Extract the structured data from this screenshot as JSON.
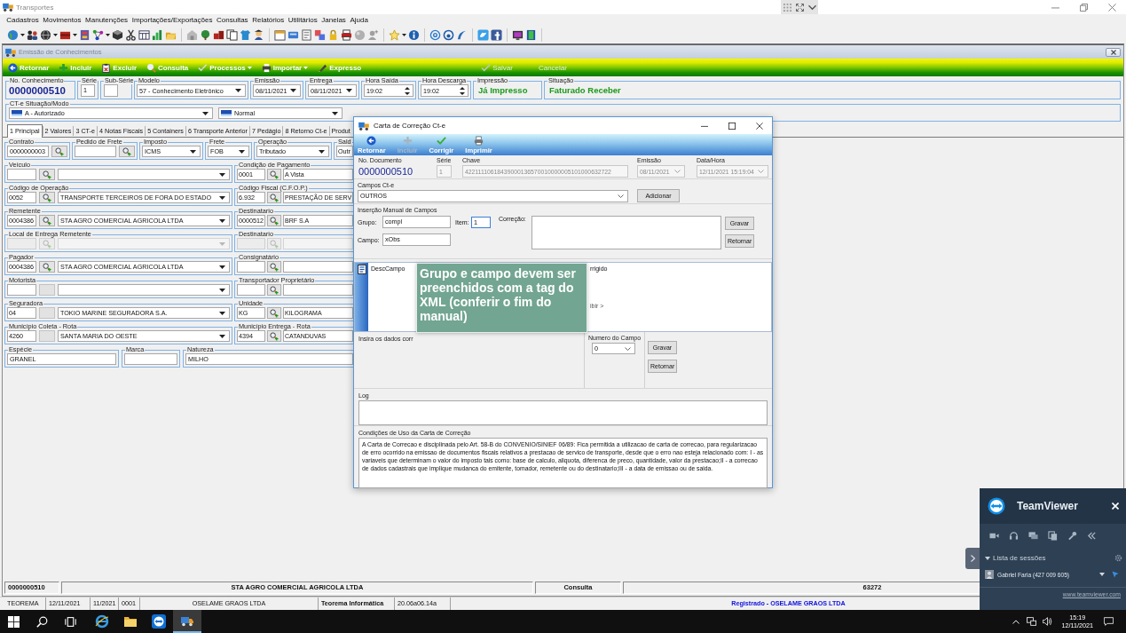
{
  "app_window": {
    "title": "Transportes"
  },
  "menu": [
    "Cadastros",
    "Movimentos",
    "Manutenções",
    "Importações/Exportações",
    "Consultas",
    "Relatórios",
    "Utilitários",
    "Janelas",
    "Ajuda"
  ],
  "child_window": {
    "title": "Emissão de Conhecimentos",
    "toolbar": [
      {
        "label": "Retornar",
        "kind": "back",
        "dropdown": false,
        "disabled": false
      },
      {
        "label": "Incluir",
        "kind": "add",
        "dropdown": false,
        "disabled": false
      },
      {
        "label": "Excluir",
        "kind": "delete",
        "dropdown": false,
        "disabled": false
      },
      {
        "label": "Consulta",
        "kind": "search",
        "dropdown": false,
        "disabled": false
      },
      {
        "label": "Processos",
        "kind": "process",
        "dropdown": true,
        "disabled": false
      },
      {
        "label": "Importar",
        "kind": "import",
        "dropdown": true,
        "disabled": false
      },
      {
        "label": "Expresso",
        "kind": "express",
        "dropdown": false,
        "disabled": false
      }
    ],
    "edit_toolbar": [
      {
        "label": "Salvar",
        "kind": "save",
        "disabled": true
      },
      {
        "label": "Cancelar",
        "kind": "cancel",
        "disabled": true
      }
    ],
    "header": [
      {
        "label": "No. Conhecimento",
        "kind": "number",
        "value": "0000000510"
      },
      {
        "label": "Série",
        "kind": "input",
        "value": "1"
      },
      {
        "label": "Sub-Série",
        "kind": "input"
      },
      {
        "label": "Modelo",
        "kind": "combo",
        "value": "57 - Conhecimento Eletrônico"
      },
      {
        "label": "Emissão",
        "kind": "combo",
        "value": "08/11/2021"
      },
      {
        "label": "Entrega",
        "kind": "combo",
        "value": "08/11/2021"
      },
      {
        "label": "Hora Saída",
        "kind": "spin",
        "value": "19:02"
      },
      {
        "label": "Hora Descarga",
        "kind": "spin",
        "value": "19:02"
      },
      {
        "label": "Impressão",
        "kind": "status",
        "value": "Já Impresso"
      },
      {
        "label": "Situação",
        "kind": "status",
        "value": "Faturado Receber"
      }
    ],
    "situation_mode": {
      "label": "CT-e Situação/Modo",
      "selects": [
        {
          "value": "A - Autorizado"
        },
        {
          "value": "Normal"
        }
      ]
    },
    "tabs": [
      {
        "label": "1 Principal",
        "selected": true
      },
      {
        "label": "2 Valores",
        "selected": false
      },
      {
        "label": "3 CT-e",
        "selected": false
      },
      {
        "label": "4 Notas Fiscais",
        "selected": false
      },
      {
        "label": "5 Containers",
        "selected": false
      },
      {
        "label": "6 Transporte Anterior",
        "selected": false
      },
      {
        "label": "7 Pedágio",
        "selected": false
      },
      {
        "label": "8 Retorno Ct-e",
        "selected": false
      },
      {
        "label": "Produt",
        "selected": false
      }
    ],
    "form": {
      "top": [
        {
          "label": "Contrato",
          "kind": "lookup",
          "value": "0000000003"
        },
        {
          "label": "Pedido de Frete",
          "kind": "lookup"
        },
        {
          "label": "Imposto",
          "kind": "combo",
          "value": "ICMS"
        },
        {
          "label": "Frete",
          "kind": "combo",
          "value": "FOB"
        },
        {
          "label": "Operação",
          "kind": "combo",
          "value": "Tributado"
        },
        {
          "label": "Sald",
          "kind": "text",
          "value": "Outr"
        }
      ],
      "rows": [
        {
          "left": {
            "label": "Veículo",
            "kind": "lookup",
            "dropdown": true,
            "disabled": false
          },
          "right": {
            "label": "Condição de Pagamento",
            "code": "0001",
            "kind": "lookup",
            "name": "A Vista",
            "dropdown": false,
            "disabled": false
          }
        },
        {
          "left": {
            "label": "Código de Operação",
            "code": "0052",
            "kind": "lookup",
            "name": "TRANSPORTE TERCEIROS DE FORA DO ESTADO",
            "dropdown": true,
            "disabled": false
          },
          "right": {
            "label": "Código Fiscal (C.F.O.P.)",
            "code": "6.932",
            "kind": "lookup",
            "name": "PRESTAÇÃO DE SERV",
            "dropdown": false,
            "disabled": false
          }
        },
        {
          "left": {
            "label": "Remetente",
            "code": "0004386",
            "kind": "lookup",
            "name": "STA AGRO COMERCIAL AGRICOLA LTDA",
            "dropdown": true,
            "disabled": false
          },
          "right": {
            "label": "Destinatario",
            "code": "0000512",
            "kind": "lookup",
            "name": "BRF S.A",
            "dropdown": false,
            "disabled": false
          }
        },
        {
          "left": {
            "label": "Local de Entrega Remetente",
            "kind": "lookup",
            "dropdown": true,
            "disabled": true
          },
          "right": {
            "label": "Destinatario",
            "kind": "lookup",
            "dropdown": false,
            "disabled": true
          }
        },
        {
          "left": {
            "label": "Pagador",
            "code": "0004386",
            "kind": "lookup",
            "name": "STA AGRO COMERCIAL AGRICOLA LTDA",
            "dropdown": true,
            "disabled": false
          },
          "right": {
            "label": "Consignatário",
            "kind": "lookup",
            "dropdown": false,
            "disabled": false
          }
        },
        {
          "left": {
            "label": "Motorista",
            "kind": "blank",
            "dropdown": true,
            "disabled": false
          },
          "right": {
            "label": "Transportador Proprietário",
            "kind": "lookup",
            "dropdown": false,
            "disabled": false
          }
        },
        {
          "left": {
            "label": "Seguradora",
            "code": "04",
            "kind": "blank",
            "name": "TOKIO MARINE SEGURADORA S.A.",
            "dropdown": true,
            "disabled": false
          },
          "right": {
            "label": "Unidade",
            "code": "KG",
            "kind": "lookup",
            "name": "KILOGRAMA",
            "dropdown": false,
            "disabled": false
          }
        },
        {
          "left": {
            "label": "Município Coleta - Rota",
            "code": "4260",
            "kind": "blank",
            "name": "SANTA MARIA DO OESTE",
            "dropdown": true,
            "disabled": false
          },
          "right": {
            "label": "Município Entrega - Rota",
            "code": "4394",
            "kind": "lookup",
            "name": "CATANDUVAS",
            "dropdown": false,
            "disabled": false
          }
        }
      ],
      "bottom": [
        {
          "label": "Espécie",
          "value": "GRANEL"
        },
        {
          "label": "Marca"
        },
        {
          "label": "Natureza",
          "value": "MILHO"
        }
      ]
    },
    "status_strip": [
      "0000000510",
      "STA AGRO COMERCIAL AGRICOLA LTDA",
      "Consulta",
      "63272"
    ]
  },
  "app_status": [
    {
      "text": "TEOREMA",
      "kind": "plain"
    },
    {
      "text": "12/11/2021",
      "kind": "plain"
    },
    {
      "text": "11/2021",
      "kind": "plain"
    },
    {
      "text": "0001",
      "kind": "plain"
    },
    {
      "text": "OSELAME GRAOS LTDA",
      "kind": "centered"
    },
    {
      "text": "Teorema Informática",
      "kind": "bold"
    },
    {
      "text": "20.06a06.14a",
      "kind": "plain"
    },
    {
      "text": "Registrado - OSELAME GRAOS LTDA",
      "kind": "highlight"
    }
  ],
  "dialog": {
    "title": "Carta de Correção Ct-e",
    "toolbar": [
      {
        "label": "Retornar",
        "kind": "back",
        "disabled": false
      },
      {
        "label": "Incluir",
        "kind": "add",
        "disabled": true
      },
      {
        "label": "Corrigir",
        "kind": "confirm",
        "disabled": false
      },
      {
        "label": "Imprimir",
        "kind": "print",
        "disabled": false
      }
    ],
    "document": {
      "label": "No. Documento",
      "value": "0000000510"
    },
    "document_fields": [
      {
        "label": "Série",
        "value": "1",
        "dropdown": false,
        "disabled": true
      },
      {
        "label": "Chave",
        "value": "42211110618439000136570010000005101000632722",
        "dropdown": false,
        "disabled": true
      },
      {
        "label": "Emissão",
        "value": "08/11/2021",
        "dropdown": true,
        "disabled": true
      },
      {
        "label": "Data/Hora",
        "value": "12/11/2021 15:19:04",
        "dropdown": true,
        "disabled": true
      }
    ],
    "cte_fields": {
      "label": "Campos Ct-e",
      "value": "OUTROS",
      "button": "Adicionar"
    },
    "manual_entry": {
      "label": "Inserção Manual de Campos",
      "group": {
        "label": "Grupo:",
        "value": "compl"
      },
      "item": {
        "label": "Item:",
        "value": "1",
        "focused": true
      },
      "field": {
        "label": "Campo:",
        "value": "xObs"
      },
      "correction": {
        "label": "Correção:"
      },
      "buttons": [
        "Gravar",
        "Retornar"
      ]
    },
    "grid": {
      "columns": [
        "DescCampo",
        "rrigido"
      ],
      "cell": "ibir >"
    },
    "tooltip": "Grupo e campo devem ser preenchidos com a tag do XML (conferir o fim do manual)",
    "data_entry": {
      "label": "Insira os dados corr",
      "field_number": {
        "label": "Numero do Campo",
        "value": "0"
      },
      "buttons": [
        "Gravar",
        "Retornar"
      ]
    },
    "log": {
      "label": "Log"
    },
    "terms": {
      "label": "Condições de Uso da Carta de Correção",
      "text": "A Carta de Correcao e disciplinada pelo Art. 58-B do CONVENIO/SINIEF 06/89: Fica permitida a utilizacao de carta de correcao, para regularizacao de erro ocorrido na emissao de documentos fiscais relativos a prestacao de servico de transporte, desde que o erro nao esteja relacionado com: I - as variaveis que determinam o valor do imposto tais como: base de calculo, aliquota, diferenca de preco, quantidade, valor da prestacao;II - a correcao de dados cadastrais que implique mudanca do emitente, tomador, remetente ou do destinatario;III - a data de emissao ou de saida."
    }
  },
  "teamviewer": {
    "title": "TeamViewer",
    "sessions_label": "Lista de sessões",
    "sessions": [
      {
        "name": "Gabriel Faria (427 009 605)"
      }
    ],
    "link": "www.teamviewer.com"
  },
  "taskbar": {
    "apps": [
      {
        "kind": "browser",
        "selected": false
      },
      {
        "kind": "folder",
        "selected": false
      },
      {
        "kind": "remote",
        "selected": false
      },
      {
        "kind": "transport",
        "selected": true
      }
    ],
    "time": "15:19",
    "date": "12/11/2021"
  }
}
